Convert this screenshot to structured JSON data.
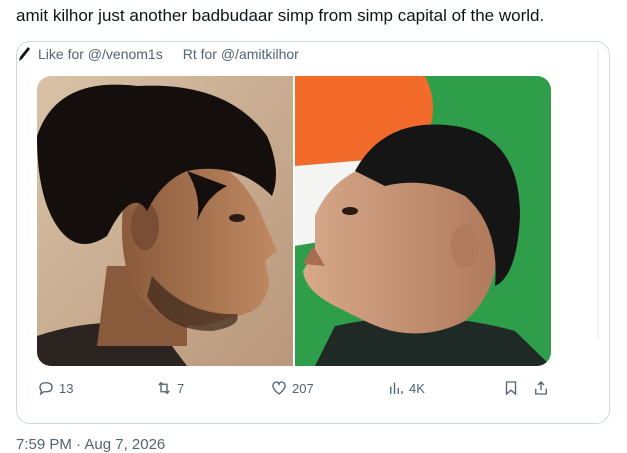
{
  "tweet": {
    "text": "amit kilhor just another badbudaar simp from simp capital of the world.",
    "timestamp": "7:59 PM · Aug 7, 2026"
  },
  "quote": {
    "header": {
      "like_text": "Like for @/venom1s",
      "rt_text": "Rt for @/amitkilhor"
    },
    "media": {
      "left_photo": "man-with-tousled-hair-in-profile",
      "right_photo": "man-in-profile-looking-up-with-flag-background"
    }
  },
  "actions": {
    "replies": "13",
    "retweets": "7",
    "likes": "207",
    "views": "4K"
  },
  "colors": {
    "text_primary": "#0f1419",
    "text_secondary": "#536471",
    "border": "#cfd9de",
    "flag_saffron": "#f26b2b",
    "flag_green": "#2e9e4a"
  }
}
